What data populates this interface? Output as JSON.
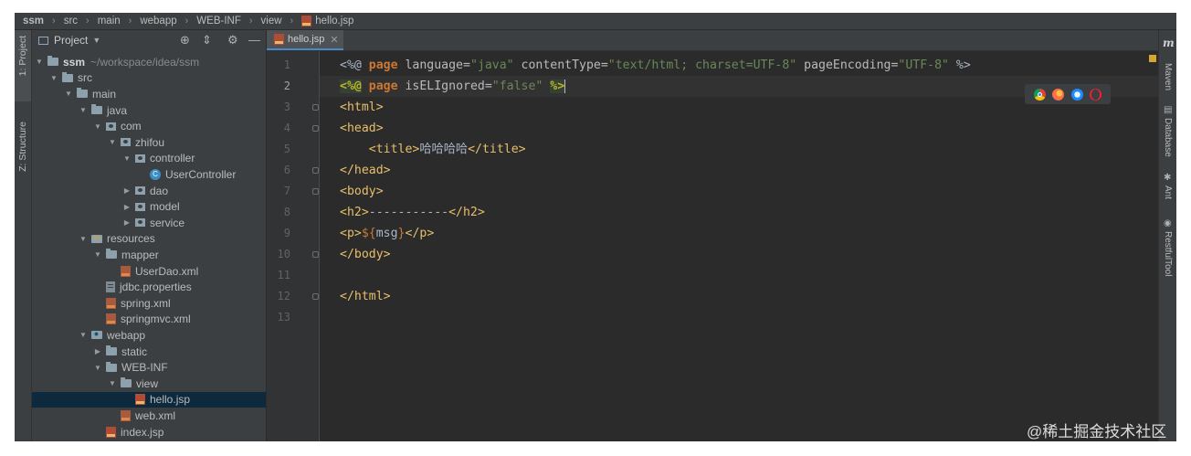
{
  "breadcrumb": [
    "ssm",
    "src",
    "main",
    "webapp",
    "WEB-INF",
    "view",
    "hello.jsp"
  ],
  "left_tool_tabs": {
    "project": "1: Project",
    "structure": "Z: Structure"
  },
  "project_panel": {
    "title": "Project",
    "tree": [
      {
        "label": "ssm",
        "path": "~/workspace/idea/ssm",
        "depth": 0,
        "expanded": true,
        "icon": "folder-icon",
        "bold": true
      },
      {
        "label": "src",
        "depth": 1,
        "expanded": true,
        "icon": "folder-icon"
      },
      {
        "label": "main",
        "depth": 2,
        "expanded": true,
        "icon": "folder-icon"
      },
      {
        "label": "java",
        "depth": 3,
        "expanded": true,
        "icon": "folder-icon"
      },
      {
        "label": "com",
        "depth": 4,
        "expanded": true,
        "icon": "package-icon"
      },
      {
        "label": "zhifou",
        "depth": 5,
        "expanded": true,
        "icon": "package-icon"
      },
      {
        "label": "controller",
        "depth": 6,
        "expanded": true,
        "icon": "package-icon"
      },
      {
        "label": "UserController",
        "depth": 7,
        "icon": "java-class-icon"
      },
      {
        "label": "dao",
        "depth": 6,
        "expanded": false,
        "icon": "package-icon"
      },
      {
        "label": "model",
        "depth": 6,
        "expanded": false,
        "icon": "package-icon"
      },
      {
        "label": "service",
        "depth": 6,
        "expanded": false,
        "icon": "package-icon"
      },
      {
        "label": "resources",
        "depth": 3,
        "expanded": true,
        "icon": "resources-folder-icon"
      },
      {
        "label": "mapper",
        "depth": 4,
        "expanded": true,
        "icon": "folder-icon"
      },
      {
        "label": "UserDao.xml",
        "depth": 5,
        "icon": "xml-file-icon"
      },
      {
        "label": "jdbc.properties",
        "depth": 4,
        "icon": "properties-file-icon"
      },
      {
        "label": "spring.xml",
        "depth": 4,
        "icon": "xml-file-icon"
      },
      {
        "label": "springmvc.xml",
        "depth": 4,
        "icon": "xml-file-icon"
      },
      {
        "label": "webapp",
        "depth": 3,
        "expanded": true,
        "icon": "web-folder-icon"
      },
      {
        "label": "static",
        "depth": 4,
        "expanded": false,
        "icon": "folder-icon"
      },
      {
        "label": "WEB-INF",
        "depth": 4,
        "expanded": true,
        "icon": "folder-icon"
      },
      {
        "label": "view",
        "depth": 5,
        "expanded": true,
        "icon": "folder-icon"
      },
      {
        "label": "hello.jsp",
        "depth": 6,
        "icon": "jsp-file-icon",
        "selected": true
      },
      {
        "label": "web.xml",
        "depth": 5,
        "icon": "xml-file-icon"
      },
      {
        "label": "index.jsp",
        "depth": 4,
        "icon": "jsp-file-icon"
      }
    ]
  },
  "editor": {
    "tab_label": "hello.jsp",
    "current_line": 2,
    "lines": [
      {
        "n": "1",
        "fold": false,
        "tokens": [
          [
            "t-text",
            "<%@ "
          ],
          [
            "t-dir",
            "page"
          ],
          [
            "t-attr",
            " language="
          ],
          [
            "t-str",
            "\"java\""
          ],
          [
            "t-attr",
            " contentType="
          ],
          [
            "t-str",
            "\"text/html; charset=UTF-8\""
          ],
          [
            "t-attr",
            " pageEncoding="
          ],
          [
            "t-str",
            "\"UTF-8\""
          ],
          [
            "t-text",
            " %>"
          ]
        ]
      },
      {
        "n": "2",
        "fold": false,
        "tokens": [
          [
            "t-hl",
            "<%@"
          ],
          [
            "t-text",
            " "
          ],
          [
            "t-dir",
            "page"
          ],
          [
            "t-attr",
            " isELIgnored="
          ],
          [
            "t-str",
            "\"false\""
          ],
          [
            "t-text",
            " "
          ],
          [
            "t-hl",
            "%>"
          ]
        ]
      },
      {
        "n": "3",
        "fold": true,
        "tokens": [
          [
            "t-tag",
            "<html>"
          ]
        ]
      },
      {
        "n": "4",
        "fold": true,
        "tokens": [
          [
            "t-tag",
            "<head>"
          ]
        ]
      },
      {
        "n": "5",
        "fold": false,
        "tokens": [
          [
            "t-text",
            "    "
          ],
          [
            "t-tag",
            "<title>"
          ],
          [
            "t-text",
            "哈哈哈哈"
          ],
          [
            "t-tag",
            "</title>"
          ]
        ]
      },
      {
        "n": "6",
        "fold": true,
        "tokens": [
          [
            "t-tag",
            "</head>"
          ]
        ]
      },
      {
        "n": "7",
        "fold": true,
        "tokens": [
          [
            "t-tag",
            "<body>"
          ]
        ]
      },
      {
        "n": "8",
        "fold": false,
        "tokens": [
          [
            "t-tag",
            "<h2>"
          ],
          [
            "t-text",
            "-----------"
          ],
          [
            "t-tag",
            "</h2>"
          ]
        ]
      },
      {
        "n": "9",
        "fold": false,
        "tokens": [
          [
            "t-tag",
            "<p>"
          ],
          [
            "t-el",
            "${"
          ],
          [
            "t-text",
            "msg"
          ],
          [
            "t-el",
            "}"
          ],
          [
            "t-tag",
            "</p>"
          ]
        ]
      },
      {
        "n": "10",
        "fold": true,
        "tokens": [
          [
            "t-tag",
            "</body>"
          ]
        ]
      },
      {
        "n": "11",
        "fold": false,
        "tokens": []
      },
      {
        "n": "12",
        "fold": true,
        "tokens": [
          [
            "t-tag",
            "</html>"
          ]
        ]
      },
      {
        "n": "13",
        "fold": false,
        "tokens": []
      }
    ]
  },
  "browser_icons": [
    "chrome-icon",
    "firefox-icon",
    "safari-icon",
    "opera-icon"
  ],
  "right_tool_tabs": [
    {
      "label": "Maven",
      "icon": "maven-icon"
    },
    {
      "label": "Database",
      "icon": "database-icon"
    },
    {
      "label": "Ant",
      "icon": "ant-icon"
    },
    {
      "label": "RestfulTool",
      "icon": "restful-icon"
    }
  ],
  "maven_logo": "m",
  "watermark": "@稀土掘金技术社区",
  "colors": {
    "editor_bg": "#2b2b2b",
    "panel_bg": "#3c3f41",
    "selection": "#0d293e",
    "tag": "#e8bf6a",
    "string": "#6a8759",
    "keyword": "#cc7832"
  }
}
